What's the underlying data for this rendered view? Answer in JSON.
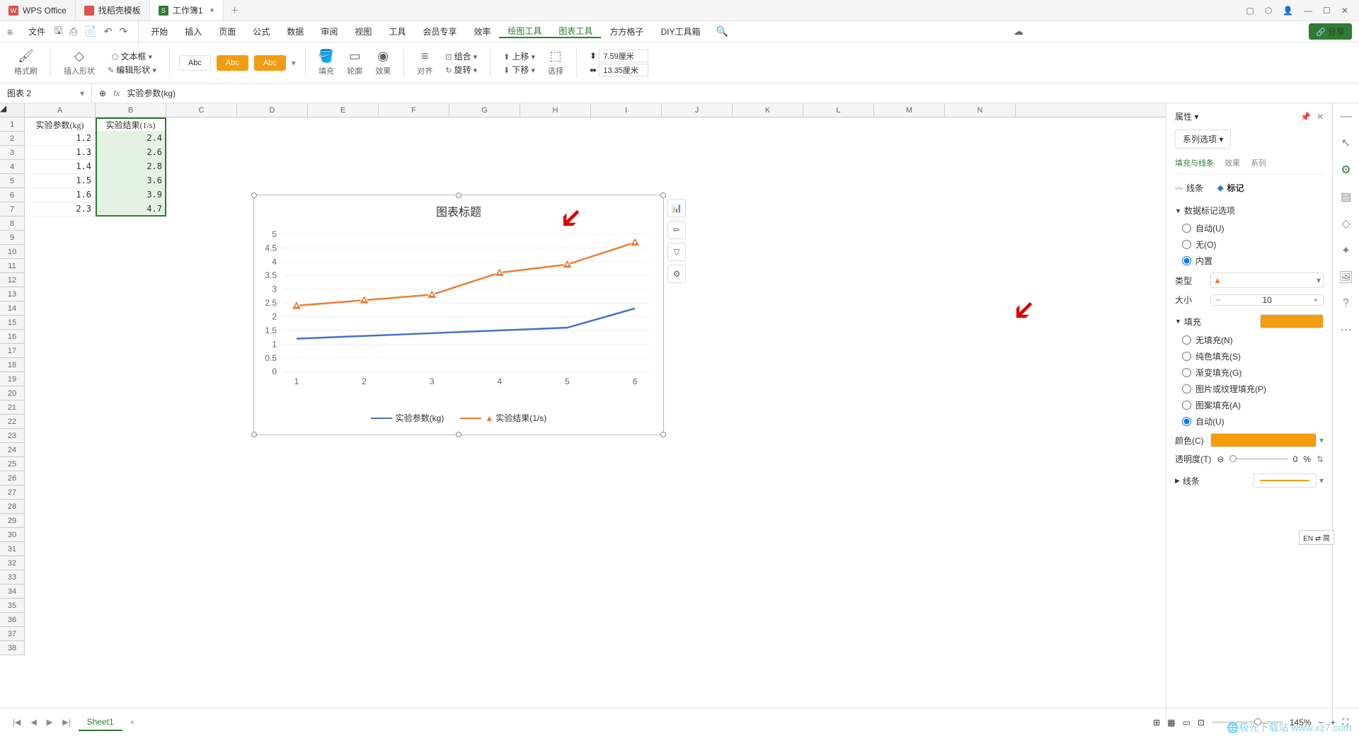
{
  "chart_data": {
    "type": "line",
    "title": "图表标题",
    "categories": [
      "1",
      "2",
      "3",
      "4",
      "5",
      "6"
    ],
    "series": [
      {
        "name": "实验参数(kg)",
        "color": "#4472c4",
        "values": [
          1.2,
          1.3,
          1.4,
          1.5,
          1.6,
          2.3
        ]
      },
      {
        "name": "实验结果(1/s)",
        "color": "#ed7d31",
        "values": [
          2.4,
          2.6,
          2.8,
          3.6,
          3.9,
          4.7
        ],
        "marker": "triangle"
      }
    ],
    "ylim": [
      0,
      5
    ],
    "ytick": 0.5,
    "xlabel": "",
    "ylabel": ""
  },
  "tabs": {
    "wps": "WPS Office",
    "templates": "找稻壳模板",
    "workbook": "工作簿1"
  },
  "menu": {
    "file": "文件",
    "start": "开始",
    "insert": "插入",
    "page": "页面",
    "formula": "公式",
    "data": "数据",
    "review": "审阅",
    "view": "视图",
    "tools": "工具",
    "member": "会员专享",
    "efficiency": "效率",
    "draw": "绘图工具",
    "chart": "图表工具",
    "cube": "方方格子",
    "diy": "DIY工具箱",
    "share": "分享"
  },
  "ribbon": {
    "brush": "格式刷",
    "insertShape": "插入形状",
    "editShape": "编辑形状",
    "textbox": "文本框",
    "abc": "Abc",
    "fill": "填充",
    "outline": "轮廓",
    "effect": "效果",
    "align": "对齐",
    "group": "组合",
    "rotate": "旋转",
    "moveUp": "上移",
    "moveDown": "下移",
    "select": "选择",
    "w": "7.59厘米",
    "h": "13.35厘米"
  },
  "nameBox": "图表 2",
  "formula": "实验参数(kg)",
  "columns": [
    "A",
    "B",
    "C",
    "D",
    "E",
    "F",
    "G",
    "H",
    "I",
    "J",
    "K",
    "L",
    "M",
    "N"
  ],
  "table": {
    "headers": [
      "实验参数(kg)",
      "实验结果(1/s)"
    ],
    "rows": [
      [
        "1.2",
        "2.4"
      ],
      [
        "1.3",
        "2.6"
      ],
      [
        "1.4",
        "2.8"
      ],
      [
        "1.5",
        "3.6"
      ],
      [
        "1.6",
        "3.9"
      ],
      [
        "2.3",
        "4.7"
      ]
    ]
  },
  "panel": {
    "title": "属性",
    "dropdown": "系列选项",
    "tabs": {
      "fill": "填充与线条",
      "effect": "效果",
      "series": "系列"
    },
    "subtabs": {
      "line": "线条",
      "marker": "标记"
    },
    "markerOptions": "数据标记选项",
    "auto": "自动(U)",
    "none": "无(O)",
    "builtin": "内置",
    "type": "类型",
    "size": "大小",
    "sizeVal": "10",
    "fillSection": "填充",
    "noFill": "无填充(N)",
    "solidFill": "纯色填充(S)",
    "gradFill": "渐变填充(G)",
    "picFill": "图片或纹理填充(P)",
    "pattFill": "图案填充(A)",
    "autoFill": "自动(U)",
    "color": "颜色(C)",
    "transparency": "透明度(T)",
    "transVal": "0",
    "transUnit": "%",
    "lineSection": "线条"
  },
  "sheetTab": "Sheet1",
  "zoom": "145%",
  "lang": "EN ⇄ 简",
  "watermark": "🌐极光下载站 www.xz7.com"
}
